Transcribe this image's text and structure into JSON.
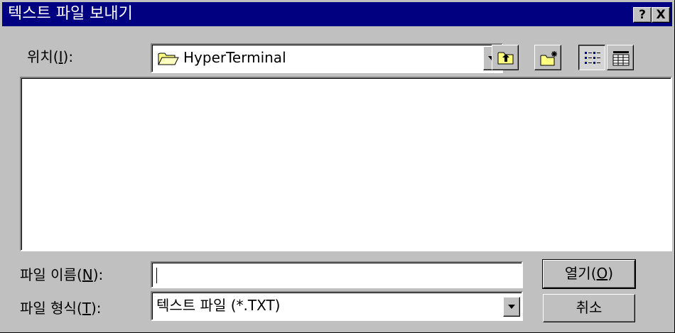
{
  "window": {
    "title": "텍스트 파일 보내기",
    "help_label": "?",
    "close_label": "X"
  },
  "location": {
    "label_before": "위치(",
    "label_key": "I",
    "label_after": "):",
    "value": "HyperTerminal"
  },
  "file_name": {
    "label_before": "파일 이름(",
    "label_key": "N",
    "label_after": "):",
    "value": ""
  },
  "file_type": {
    "label_before": "파일 형식(",
    "label_key": "T",
    "label_after": "):",
    "value": "텍스트 파일 (*.TXT)"
  },
  "buttons": {
    "open_before": "열기(",
    "open_key": "O",
    "open_after": ")",
    "cancel": "취소"
  },
  "toolbar": {
    "up_folder": "up-one-level-icon",
    "new_folder": "new-folder-icon",
    "list_view": "list-view-icon",
    "details_view": "details-view-icon"
  },
  "file_list": {
    "items": []
  }
}
